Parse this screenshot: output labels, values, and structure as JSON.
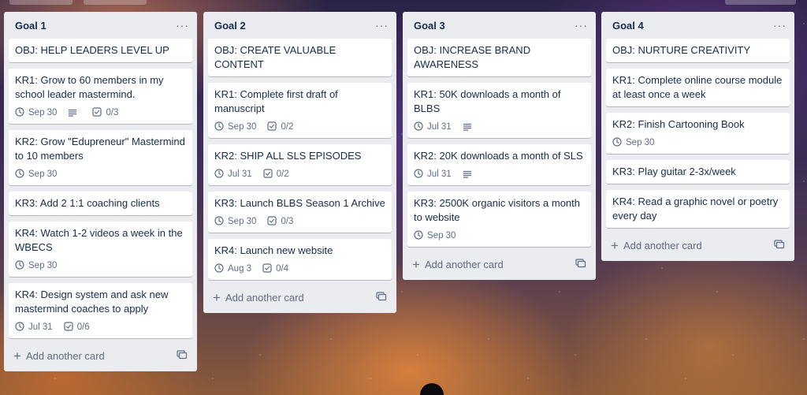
{
  "board": {
    "add_card_label": "Add another card",
    "lists": [
      {
        "title": "Goal 1",
        "cards": [
          {
            "title": "OBJ: HELP LEADERS LEVEL UP"
          },
          {
            "title": "KR1: Grow to 60 members in my school leader mastermind.",
            "due": "Sep 30",
            "description": true,
            "checklist": "0/3"
          },
          {
            "title": "KR2: Grow \"Edupreneur\" Mastermind to 10 members",
            "due": "Sep 30"
          },
          {
            "title": "KR3: Add 2 1:1 coaching clients"
          },
          {
            "title": "KR4: Watch 1-2 videos a week in the WBECS",
            "due": "Sep 30"
          },
          {
            "title": "KR4: Design system and ask new mastermind coaches to apply",
            "due": "Jul 31",
            "checklist": "0/6"
          }
        ]
      },
      {
        "title": "Goal 2",
        "cards": [
          {
            "title": "OBJ: CREATE VALUABLE CONTENT"
          },
          {
            "title": "KR1: Complete first draft of manuscript",
            "due": "Sep 30",
            "checklist": "0/2"
          },
          {
            "title": "KR2: SHIP ALL SLS EPISODES",
            "due": "Jul 31",
            "checklist": "0/2"
          },
          {
            "title": "KR3: Launch BLBS Season 1 Archive",
            "due": "Sep 30",
            "checklist": "0/3"
          },
          {
            "title": "KR4: Launch new website",
            "due": "Aug 3",
            "checklist": "0/4"
          }
        ]
      },
      {
        "title": "Goal 3",
        "cards": [
          {
            "title": "OBJ: INCREASE BRAND AWARENESS"
          },
          {
            "title": "KR1: 50K downloads a month of BLBS",
            "due": "Jul 31",
            "description": true
          },
          {
            "title": "KR2: 20K downloads a month of SLS",
            "due": "Jul 31",
            "description": true
          },
          {
            "title": "KR3: 2500K organic visitors a month to website",
            "due": "Sep 30"
          }
        ]
      },
      {
        "title": "Goal 4",
        "cards": [
          {
            "title": "OBJ: NURTURE CREATIVITY"
          },
          {
            "title": "KR1: Complete online course module at least once a week"
          },
          {
            "title": "KR2: Finish Cartooning Book",
            "due": "Sep 30"
          },
          {
            "title": "KR3: Play guitar 2-3x/week"
          },
          {
            "title": "KR4: Read a graphic novel or poetry every day"
          }
        ]
      }
    ]
  },
  "icons": {
    "list_menu": "ellipsis-icon",
    "due": "clock-icon",
    "description": "description-icon",
    "checklist": "checklist-icon",
    "add": "plus-icon",
    "template": "card-template-icon"
  },
  "colors": {
    "list_bg": "#ebecf0",
    "card_bg": "#ffffff",
    "text": "#172b4d",
    "muted": "#5e6c84"
  }
}
